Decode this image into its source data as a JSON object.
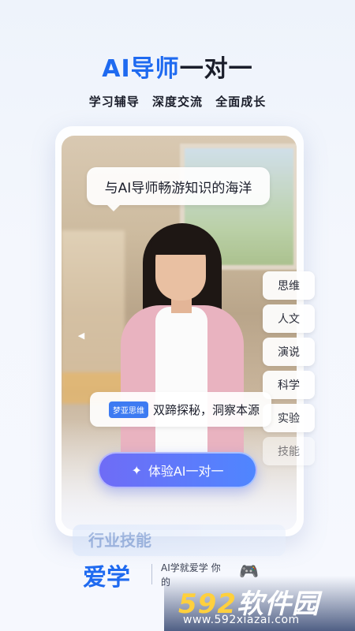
{
  "headline": {
    "part1": "AI导师",
    "part2": "一对一"
  },
  "subline": [
    "学习辅导",
    "深度交流",
    "全面成长"
  ],
  "bubble": {
    "text": "与AI导师畅游知识的海洋"
  },
  "side_tags": [
    "思维",
    "人文",
    "演说",
    "科学",
    "实验",
    "技能"
  ],
  "quote": {
    "badge": "梦亚思维",
    "text": "双蹄探秘，洞察本源"
  },
  "cta": {
    "label": "体验AI一对一",
    "icon": "sparkle-icon"
  },
  "ghost_banner": {
    "text": "行业技能"
  },
  "footer": {
    "logo": "爱学",
    "slogan": "AI学就爱学 你的"
  },
  "watermark": {
    "num": "592",
    "brand": "软件园",
    "url": "www.592xiazai.com"
  },
  "colors": {
    "accent": "#1f6af0",
    "cta_start": "#6f6cf6",
    "cta_end": "#4f86ff"
  }
}
